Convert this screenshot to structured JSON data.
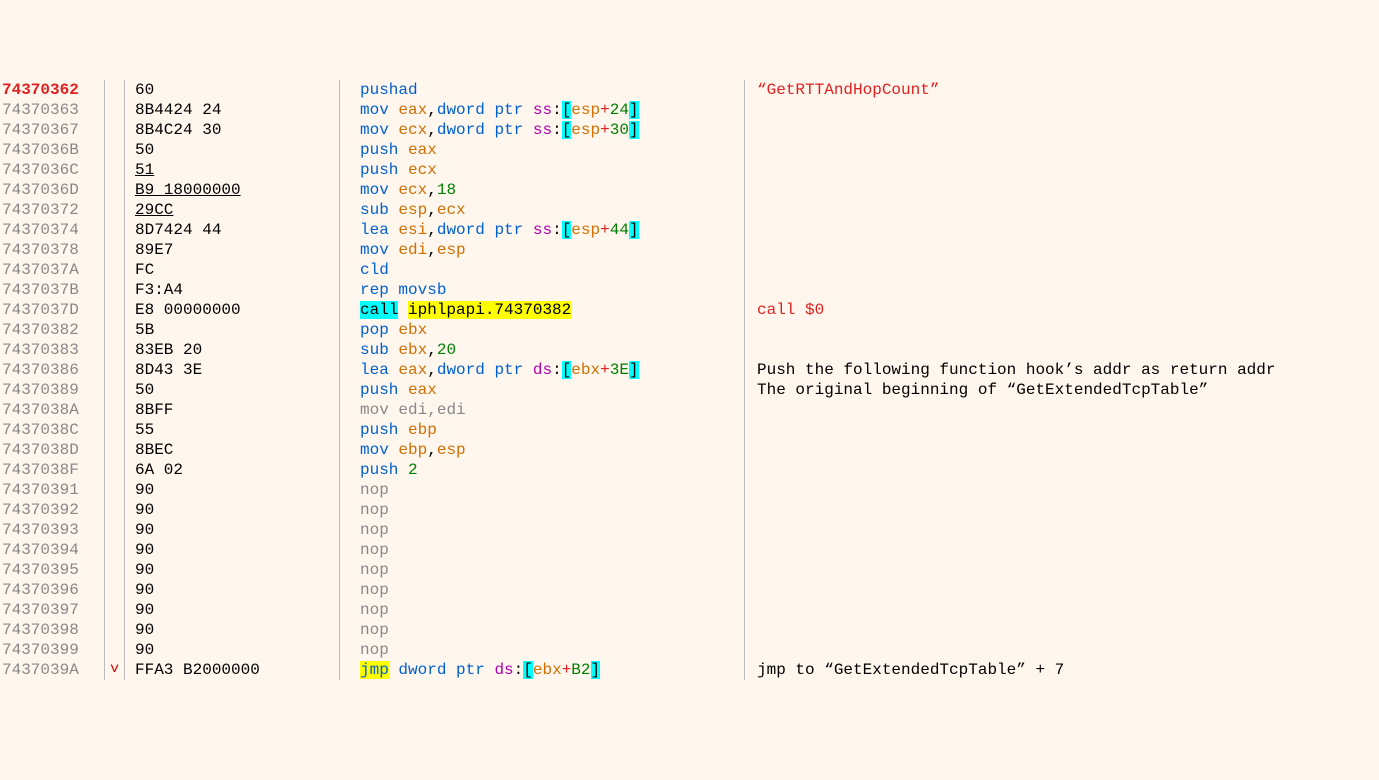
{
  "rows": [
    {
      "addr": "74370362",
      "addr_sel": true,
      "bytes": "60",
      "dis": [
        {
          "t": "pushad",
          "c": "mnem"
        }
      ],
      "comment": "“GetRTTAndHopCount”",
      "com_red": true
    },
    {
      "addr": "74370363",
      "bytes": "8B4424 24",
      "dis": [
        {
          "t": "mov",
          "c": "mnem"
        },
        {
          "t": " "
        },
        {
          "t": "eax",
          "c": "reg"
        },
        {
          "t": ","
        },
        {
          "t": "dword ptr",
          "c": "mnem"
        },
        {
          "t": " "
        },
        {
          "t": "ss",
          "c": "seg"
        },
        {
          "t": ":"
        },
        {
          "t": "[",
          "c": "br"
        },
        {
          "t": "esp",
          "c": "reg"
        },
        {
          "t": "+",
          "c": "plus"
        },
        {
          "t": "24",
          "c": "num"
        },
        {
          "t": "]",
          "c": "br"
        }
      ]
    },
    {
      "addr": "74370367",
      "bytes": "8B4C24 30",
      "dis": [
        {
          "t": "mov",
          "c": "mnem"
        },
        {
          "t": " "
        },
        {
          "t": "ecx",
          "c": "reg"
        },
        {
          "t": ","
        },
        {
          "t": "dword ptr",
          "c": "mnem"
        },
        {
          "t": " "
        },
        {
          "t": "ss",
          "c": "seg"
        },
        {
          "t": ":"
        },
        {
          "t": "[",
          "c": "br"
        },
        {
          "t": "esp",
          "c": "reg"
        },
        {
          "t": "+",
          "c": "plus"
        },
        {
          "t": "30",
          "c": "num"
        },
        {
          "t": "]",
          "c": "br"
        }
      ]
    },
    {
      "addr": "7437036B",
      "bytes": "50",
      "dis": [
        {
          "t": "push",
          "c": "mnem"
        },
        {
          "t": " "
        },
        {
          "t": "eax",
          "c": "reg"
        }
      ]
    },
    {
      "addr": "7437036C",
      "bytes": "51",
      "bytes_u": true,
      "dis": [
        {
          "t": "push",
          "c": "mnem"
        },
        {
          "t": " "
        },
        {
          "t": "ecx",
          "c": "reg"
        }
      ]
    },
    {
      "addr": "7437036D",
      "bytes": "B9 18000000",
      "bytes_u": true,
      "dis": [
        {
          "t": "mov",
          "c": "mnem"
        },
        {
          "t": " "
        },
        {
          "t": "ecx",
          "c": "reg"
        },
        {
          "t": ","
        },
        {
          "t": "18",
          "c": "num"
        }
      ]
    },
    {
      "addr": "74370372",
      "bytes": "29CC",
      "bytes_u": true,
      "dis": [
        {
          "t": "sub",
          "c": "mnem"
        },
        {
          "t": " "
        },
        {
          "t": "esp",
          "c": "reg"
        },
        {
          "t": ","
        },
        {
          "t": "ecx",
          "c": "reg"
        }
      ]
    },
    {
      "addr": "74370374",
      "bytes": "8D7424 44",
      "dis": [
        {
          "t": "lea",
          "c": "mnem"
        },
        {
          "t": " "
        },
        {
          "t": "esi",
          "c": "reg"
        },
        {
          "t": ","
        },
        {
          "t": "dword ptr",
          "c": "mnem"
        },
        {
          "t": " "
        },
        {
          "t": "ss",
          "c": "seg"
        },
        {
          "t": ":"
        },
        {
          "t": "[",
          "c": "br"
        },
        {
          "t": "esp",
          "c": "reg"
        },
        {
          "t": "+",
          "c": "plus"
        },
        {
          "t": "44",
          "c": "num"
        },
        {
          "t": "]",
          "c": "br"
        }
      ]
    },
    {
      "addr": "74370378",
      "bytes": "89E7",
      "dis": [
        {
          "t": "mov",
          "c": "mnem"
        },
        {
          "t": " "
        },
        {
          "t": "edi",
          "c": "reg"
        },
        {
          "t": ","
        },
        {
          "t": "esp",
          "c": "reg"
        }
      ]
    },
    {
      "addr": "7437037A",
      "bytes": "FC",
      "dis": [
        {
          "t": "cld",
          "c": "mnem"
        }
      ]
    },
    {
      "addr": "7437037B",
      "bytes": "F3:A4",
      "dis": [
        {
          "t": "rep",
          "c": "mnem"
        },
        {
          "t": " "
        },
        {
          "t": "movsb",
          "c": "mnem"
        }
      ]
    },
    {
      "addr": "7437037D",
      "bytes": "E8 00000000",
      "dis": [
        {
          "t": "call",
          "c": "mnem br"
        },
        {
          "t": " "
        },
        {
          "t": "iphlpapi.74370382",
          "c": "hl-y"
        }
      ],
      "comment": "call $0",
      "com_red": true
    },
    {
      "addr": "74370382",
      "bytes": "5B",
      "dis": [
        {
          "t": "pop",
          "c": "mnem"
        },
        {
          "t": " "
        },
        {
          "t": "ebx",
          "c": "reg"
        }
      ]
    },
    {
      "addr": "74370383",
      "bytes": "83EB 20",
      "dis": [
        {
          "t": "sub",
          "c": "mnem"
        },
        {
          "t": " "
        },
        {
          "t": "ebx",
          "c": "reg"
        },
        {
          "t": ","
        },
        {
          "t": "20",
          "c": "num"
        }
      ]
    },
    {
      "addr": "74370386",
      "bytes": "8D43 3E",
      "dis": [
        {
          "t": "lea",
          "c": "mnem"
        },
        {
          "t": " "
        },
        {
          "t": "eax",
          "c": "reg"
        },
        {
          "t": ","
        },
        {
          "t": "dword ptr",
          "c": "mnem"
        },
        {
          "t": " "
        },
        {
          "t": "ds",
          "c": "seg"
        },
        {
          "t": ":"
        },
        {
          "t": "[",
          "c": "br"
        },
        {
          "t": "ebx",
          "c": "reg"
        },
        {
          "t": "+",
          "c": "plus"
        },
        {
          "t": "3E",
          "c": "num"
        },
        {
          "t": "]",
          "c": "br"
        }
      ],
      "comment": "Push the following function hook’s addr as return addr"
    },
    {
      "addr": "74370389",
      "bytes": "50",
      "dis": [
        {
          "t": "push",
          "c": "mnem"
        },
        {
          "t": " "
        },
        {
          "t": "eax",
          "c": "reg"
        }
      ],
      "comment": "The original beginning of “GetExtendedTcpTable”"
    },
    {
      "addr": "7437038A",
      "bytes": "8BFF",
      "dis": [
        {
          "t": "mov",
          "c": "gray"
        },
        {
          "t": " "
        },
        {
          "t": "edi",
          "c": "gray"
        },
        {
          "t": ",",
          "c": "gray"
        },
        {
          "t": "edi",
          "c": "gray"
        }
      ]
    },
    {
      "addr": "7437038C",
      "bytes": "55",
      "dis": [
        {
          "t": "push",
          "c": "mnem"
        },
        {
          "t": " "
        },
        {
          "t": "ebp",
          "c": "reg"
        }
      ]
    },
    {
      "addr": "7437038D",
      "bytes": "8BEC",
      "dis": [
        {
          "t": "mov",
          "c": "mnem"
        },
        {
          "t": " "
        },
        {
          "t": "ebp",
          "c": "reg"
        },
        {
          "t": ","
        },
        {
          "t": "esp",
          "c": "reg"
        }
      ]
    },
    {
      "addr": "7437038F",
      "bytes": "6A 02",
      "dis": [
        {
          "t": "push",
          "c": "mnem"
        },
        {
          "t": " "
        },
        {
          "t": "2",
          "c": "num"
        }
      ]
    },
    {
      "addr": "74370391",
      "bytes": "90",
      "dis": [
        {
          "t": "nop",
          "c": "gray"
        }
      ]
    },
    {
      "addr": "74370392",
      "bytes": "90",
      "dis": [
        {
          "t": "nop",
          "c": "gray"
        }
      ]
    },
    {
      "addr": "74370393",
      "bytes": "90",
      "dis": [
        {
          "t": "nop",
          "c": "gray"
        }
      ]
    },
    {
      "addr": "74370394",
      "bytes": "90",
      "dis": [
        {
          "t": "nop",
          "c": "gray"
        }
      ]
    },
    {
      "addr": "74370395",
      "bytes": "90",
      "dis": [
        {
          "t": "nop",
          "c": "gray"
        }
      ]
    },
    {
      "addr": "74370396",
      "bytes": "90",
      "dis": [
        {
          "t": "nop",
          "c": "gray"
        }
      ]
    },
    {
      "addr": "74370397",
      "bytes": "90",
      "dis": [
        {
          "t": "nop",
          "c": "gray"
        }
      ]
    },
    {
      "addr": "74370398",
      "bytes": "90",
      "dis": [
        {
          "t": "nop",
          "c": "gray"
        }
      ]
    },
    {
      "addr": "74370399",
      "bytes": "90",
      "dis": [
        {
          "t": "nop",
          "c": "gray"
        }
      ]
    },
    {
      "addr": "7437039A",
      "mark": "˅",
      "bytes": "FFA3 B2000000",
      "dis": [
        {
          "t": "jmp",
          "c": "mnem hl-y"
        },
        {
          "t": " "
        },
        {
          "t": "dword ptr",
          "c": "mnem"
        },
        {
          "t": " "
        },
        {
          "t": "ds",
          "c": "seg"
        },
        {
          "t": ":"
        },
        {
          "t": "[",
          "c": "br"
        },
        {
          "t": "ebx",
          "c": "reg"
        },
        {
          "t": "+",
          "c": "plus"
        },
        {
          "t": "B2",
          "c": "num"
        },
        {
          "t": "]",
          "c": "br"
        }
      ],
      "comment": "jmp to “GetExtendedTcpTable” + 7"
    }
  ]
}
